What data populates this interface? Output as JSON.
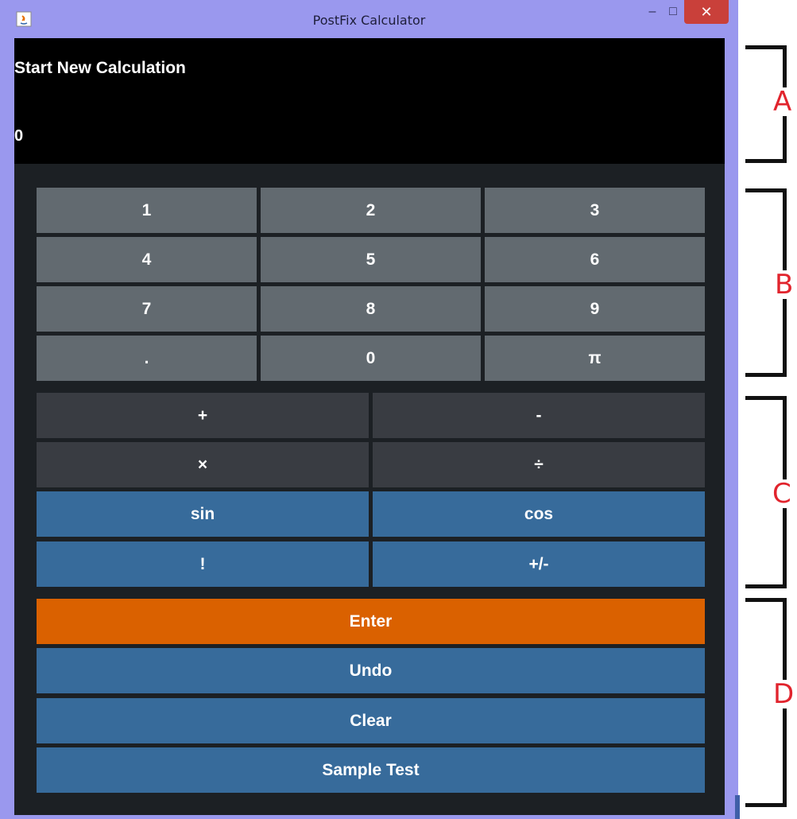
{
  "window": {
    "title": "PostFix Calculator",
    "controls": {
      "minimize": "–",
      "maximize": "□",
      "close": "✕"
    }
  },
  "display": {
    "status": "Start New Calculation",
    "value": "0"
  },
  "numpad": [
    "1",
    "2",
    "3",
    "4",
    "5",
    "6",
    "7",
    "8",
    "9",
    ".",
    "0",
    "π"
  ],
  "operators": [
    "+",
    "-",
    "×",
    "÷"
  ],
  "functions": [
    "sin",
    "cos",
    "!",
    "+/-"
  ],
  "actions": {
    "enter": "Enter",
    "undo": "Undo",
    "clear": "Clear",
    "sample_test": "Sample Test"
  },
  "annotations": [
    "A",
    "B",
    "C",
    "D"
  ],
  "colors": {
    "number_key": "#626a70",
    "operator_key": "#393c42",
    "function_key": "#376b9b",
    "enter_key": "#da6100",
    "annotation": "#e1242d"
  }
}
